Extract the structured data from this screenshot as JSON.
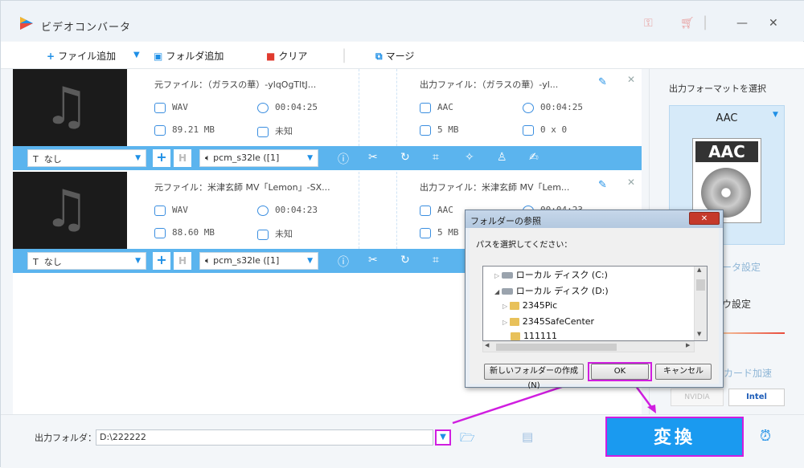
{
  "app": {
    "title": "ビデオコンバータ"
  },
  "toolbar": {
    "add_file": "ファイル追加",
    "add_folder": "フォルダ追加",
    "clear": "クリア",
    "merge": "マージ"
  },
  "files": [
    {
      "source_label": "元ファイル：（ガラスの華）-ylqOgTltJ...",
      "source_format": "WAV",
      "source_duration": "00:04:25",
      "source_size": "89.21 MB",
      "source_resolution": "未知",
      "output_label": "出力ファイル：（ガラスの華）-yl...",
      "output_format": "AAC",
      "output_duration": "00:04:25",
      "output_size": "5 MB",
      "output_resolution": "0 x 0",
      "subtitle": "なし",
      "audio": "pcm_s32le ([1]"
    },
    {
      "source_label": "元ファイル：米津玄師 MV「Lemon」-SX...",
      "source_format": "WAV",
      "source_duration": "00:04:23",
      "source_size": "88.60 MB",
      "source_resolution": "未知",
      "output_label": "出力ファイル：米津玄師 MV「Lem...",
      "output_format": "AAC",
      "output_duration": "00:04:23",
      "output_size": "5 MB",
      "output_resolution": "",
      "subtitle": "なし",
      "audio": "pcm_s32le ([1]"
    }
  ],
  "right_panel": {
    "select_format": "出力フォーマットを選択",
    "format_name": "AAC",
    "format_icon_text": "AAC",
    "param_settings": "ータ設定",
    "settings2": "ウ設定",
    "gpu_accel": "カード加速",
    "nvidia": "NVIDIA",
    "intel": "Intel"
  },
  "bottom": {
    "output_folder_label": "出力フォルダ：",
    "output_folder_value": "D:\\222222",
    "convert": "変換"
  },
  "dialog": {
    "title": "フォルダーの参照",
    "prompt": "パスを選択してください：",
    "tree": [
      "ローカル ディスク (C:)",
      "ローカル ディスク (D:)",
      "2345Pic",
      "2345SafeCenter",
      "111111"
    ],
    "new_folder": "新しいフォルダーの作成(N)",
    "ok": "OK",
    "cancel": "キャンセル",
    "close": "✕"
  },
  "colors": {
    "accent": "#1a9af0",
    "highlight": "#d01ee0",
    "editbar": "#5bb4ee"
  }
}
